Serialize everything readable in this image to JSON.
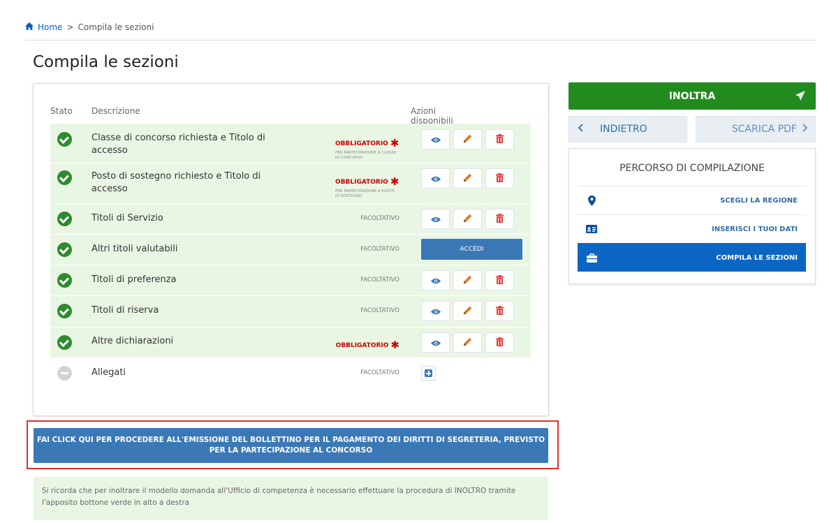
{
  "breadcrumb": {
    "home": "Home",
    "separator": ">",
    "current": "Compila le sezioni"
  },
  "page_title": "Compila le sezioni",
  "table": {
    "col_stato": "Stato",
    "col_descrizione": "Descrizione",
    "col_azioni": "Azioni disponibili",
    "rows": [
      {
        "status": "completed",
        "description": "Classe di concorso richiesta e Titolo di accesso",
        "requirement": "OBBLIGATORIO",
        "requirement_note": "PER PARTECIPAZIONE A CLASSE DI CONCORSO",
        "actions": [
          "view",
          "edit",
          "delete"
        ]
      },
      {
        "status": "completed",
        "description": "Posto di sostegno richiesto e Titolo di accesso",
        "requirement": "OBBLIGATORIO",
        "requirement_note": "PER PARTECIPAZIONE A POSTO DI SOSTEGNO",
        "actions": [
          "view",
          "edit",
          "delete"
        ]
      },
      {
        "status": "completed",
        "description": "Titoli di Servizio",
        "requirement": "FACOLTATIVO",
        "actions": [
          "view",
          "edit",
          "delete"
        ]
      },
      {
        "status": "completed",
        "description": "Altri titoli valutabili",
        "requirement": "FACOLTATIVO",
        "action_label": "ACCEDI"
      },
      {
        "status": "completed",
        "description": "Titoli di preferenza",
        "requirement": "FACOLTATIVO",
        "actions": [
          "view",
          "edit",
          "delete"
        ]
      },
      {
        "status": "completed",
        "description": "Titoli di riserva",
        "requirement": "FACOLTATIVO",
        "actions": [
          "view",
          "edit",
          "delete"
        ]
      },
      {
        "status": "completed",
        "description": "Altre dichiarazioni",
        "requirement": "OBBLIGATORIO",
        "actions": [
          "view",
          "edit",
          "delete"
        ]
      },
      {
        "status": "pending",
        "description": "Allegati",
        "requirement": "FACOLTATIVO",
        "actions": [
          "add"
        ]
      }
    ]
  },
  "payment_button": "FAI CLICK QUI PER PROCEDERE ALL'EMISSIONE DEL BOLLETTINO PER IL PAGAMENTO DEI DIRITTI DI SEGRETERIA, PREVISTO PER LA PARTECIPAZIONE AL CONCORSO",
  "note": "Si ricorda che per inoltrare il modello domanda all'Ufficio di competenza è necessario effettuare la procedura di INOLTRO tramite l'apposito bottone verde in alto a destra",
  "sidebar": {
    "inoltra": "INOLTRA",
    "indietro": "INDIETRO",
    "scarica_pdf": "SCARICA PDF",
    "percorso_title": "PERCORSO DI COMPILAZIONE",
    "steps": [
      {
        "label": "SCEGLI LA REGIONE",
        "icon": "map-marker-icon",
        "active": false
      },
      {
        "label": "INSERISCI I TUOI DATI",
        "icon": "id-card-icon",
        "active": false
      },
      {
        "label": "COMPILA LE SEZIONI",
        "icon": "briefcase-icon",
        "active": true
      }
    ]
  },
  "colors": {
    "primary_blue": "#3b78b6",
    "green": "#228b1e",
    "row_green": "#e9f6e4",
    "required_red": "#cc0000"
  }
}
